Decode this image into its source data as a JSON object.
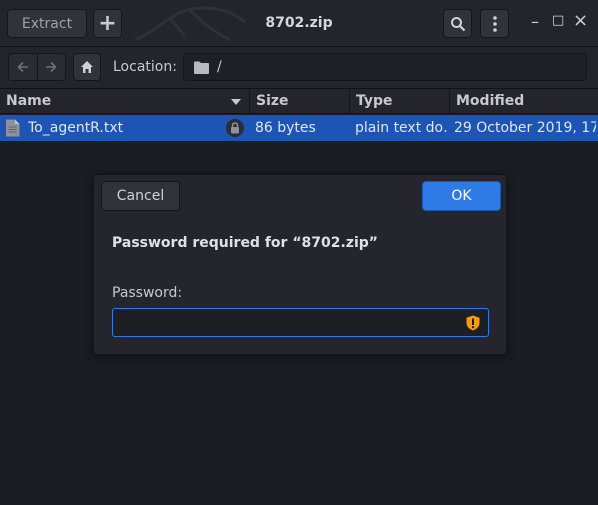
{
  "header": {
    "extract_label": "Extract",
    "add_label": "+",
    "title": "8702.zip",
    "minimize": "–",
    "maximize": "□",
    "close": "×"
  },
  "location": {
    "label": "Location:",
    "path": "/"
  },
  "columns": {
    "name": "Name",
    "size": "Size",
    "type": "Type",
    "modified": "Modified"
  },
  "files": [
    {
      "name": "To_agentR.txt",
      "size": "86 bytes",
      "type": "plain text do…",
      "modified": "29 October 2019, 17…"
    }
  ],
  "dialog": {
    "cancel_label": "Cancel",
    "ok_label": "OK",
    "title": "Password required for “8702.zip”",
    "password_label": "Password:",
    "password_value": ""
  },
  "colors": {
    "accent": "#2f7be6",
    "selection": "#1c55b4",
    "warning": "#f39c12"
  }
}
